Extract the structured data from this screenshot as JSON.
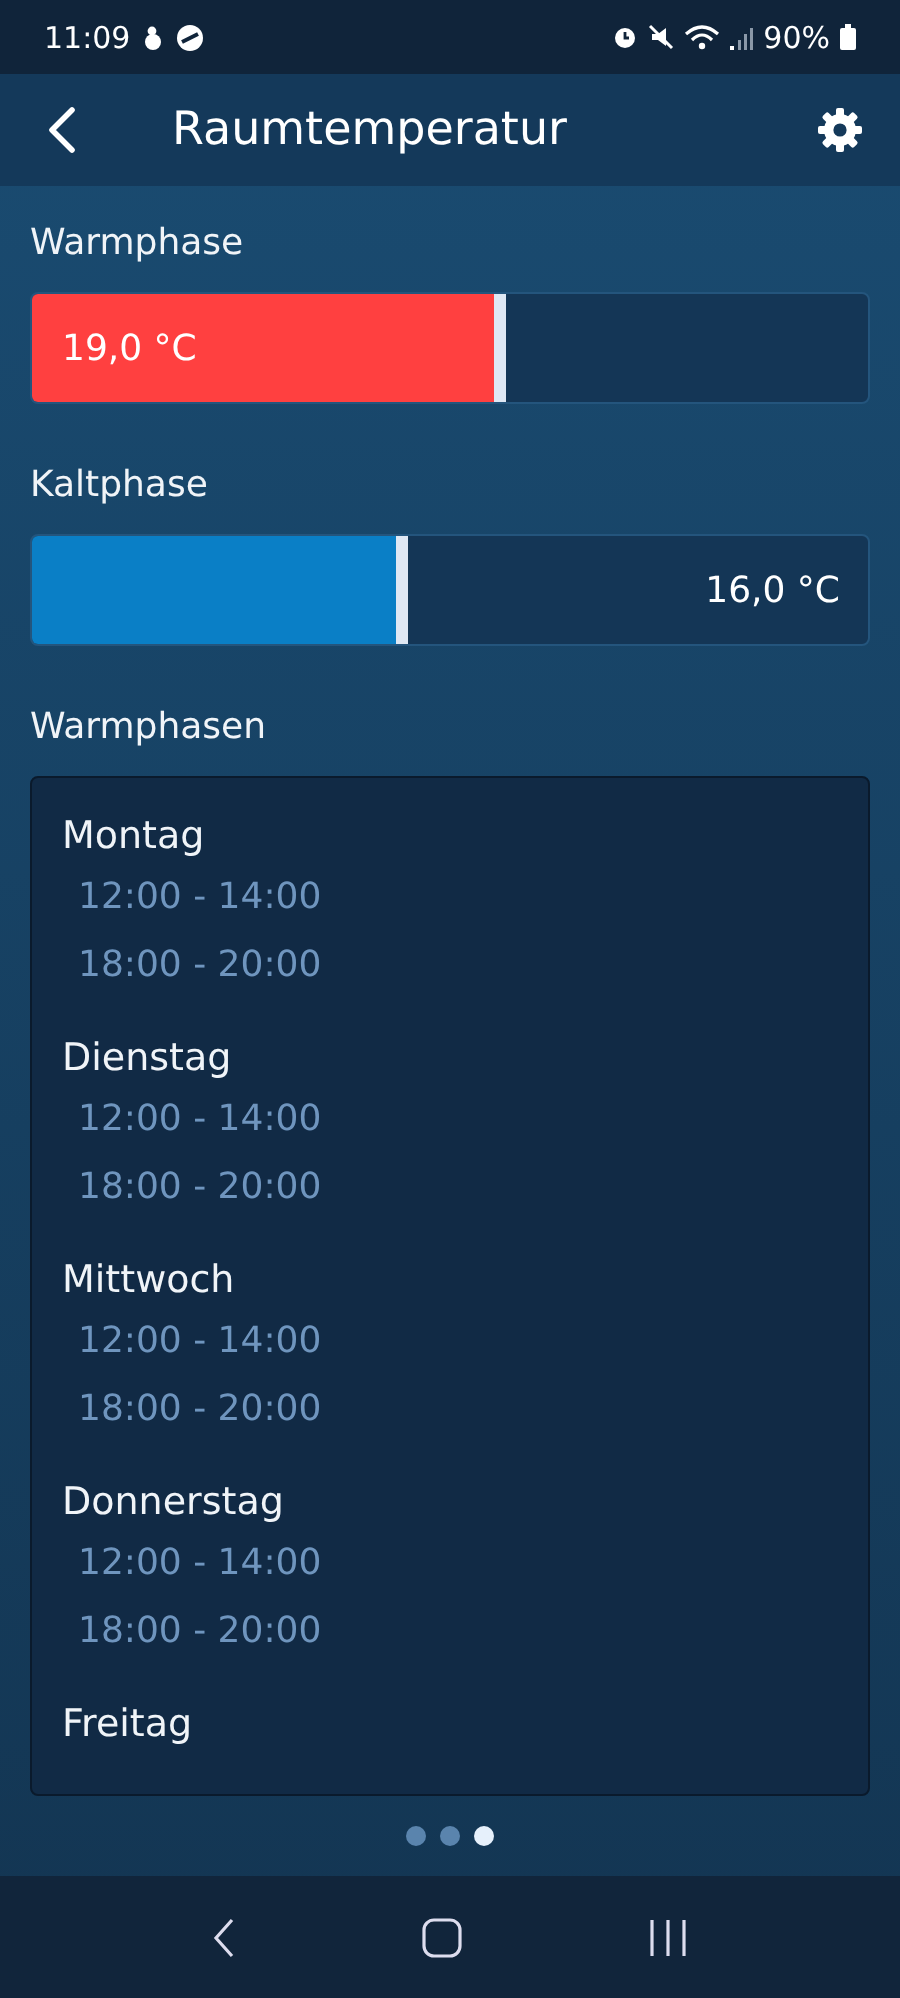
{
  "status_bar": {
    "time": "11:09",
    "battery": "90%"
  },
  "header": {
    "title": "Raumtemperatur"
  },
  "sliders": [
    {
      "kind": "warm",
      "label": "Warmphase",
      "level": 0.566,
      "reading": "19,0 °C"
    },
    {
      "kind": "cold",
      "label": "Kaltphase",
      "level": 0.449,
      "reading": "16,0 °C"
    }
  ],
  "schedule": {
    "title": "Warmphasen",
    "days": [
      {
        "name": "Montag",
        "times": [
          "12:00 - 14:00",
          "18:00 - 20:00"
        ]
      },
      {
        "name": "Dienstag",
        "times": [
          "12:00 - 14:00",
          "18:00 - 20:00"
        ]
      },
      {
        "name": "Mittwoch",
        "times": [
          "12:00 - 14:00",
          "18:00 - 20:00"
        ]
      },
      {
        "name": "Donnerstag",
        "times": [
          "12:00 - 14:00",
          "18:00 - 20:00"
        ]
      },
      {
        "name": "Freitag"
      }
    ]
  },
  "page_dots": [
    {
      "selected": false
    },
    {
      "selected": false
    },
    {
      "selected": true
    }
  ]
}
